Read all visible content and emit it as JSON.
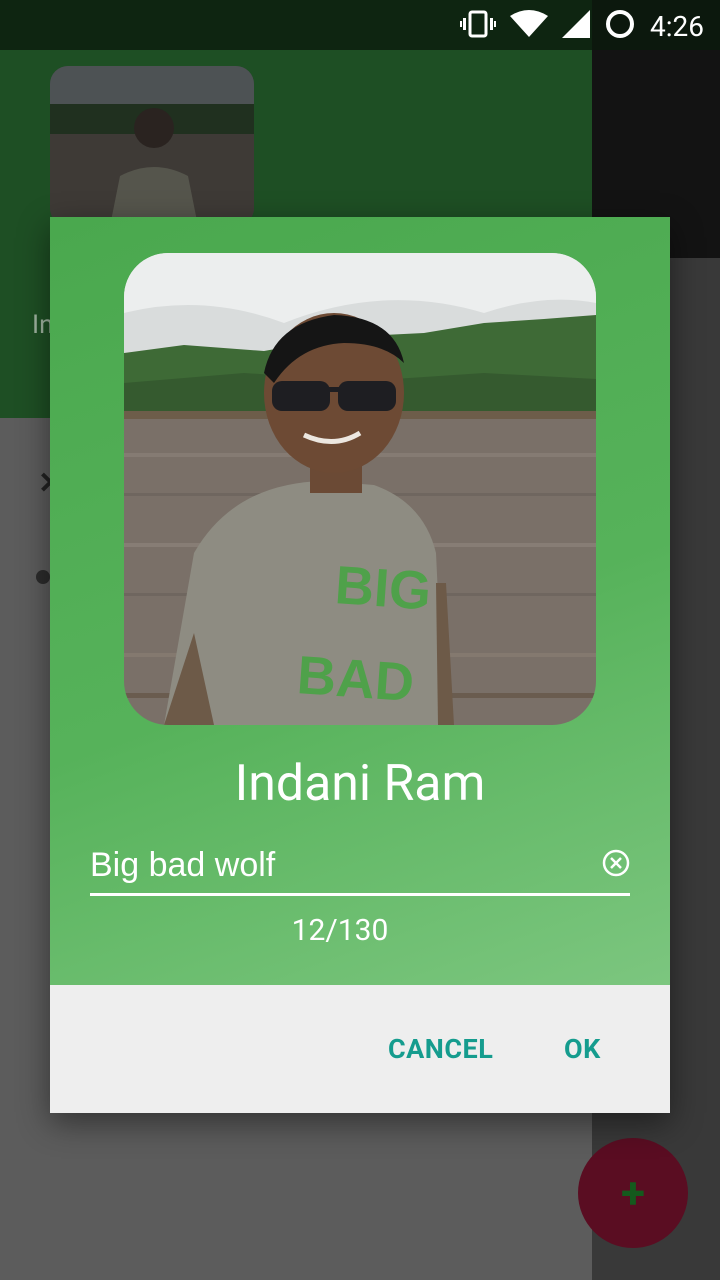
{
  "status_bar": {
    "time": "4:26",
    "icons": [
      "vibrate-icon",
      "wifi-icon",
      "signal-icon",
      "sync-icon"
    ]
  },
  "dialog": {
    "name": "Indani Ram",
    "status_value": "Big bad wolf",
    "char_counter": "12/130",
    "cancel_label": "CANCEL",
    "ok_label": "OK"
  },
  "background": {
    "title_fragment": "In",
    "fab_label": "+"
  },
  "colors": {
    "dialog_green": "#4aa84e",
    "button_teal": "#159c8e",
    "dialog_bottom": "#eeeeee"
  }
}
